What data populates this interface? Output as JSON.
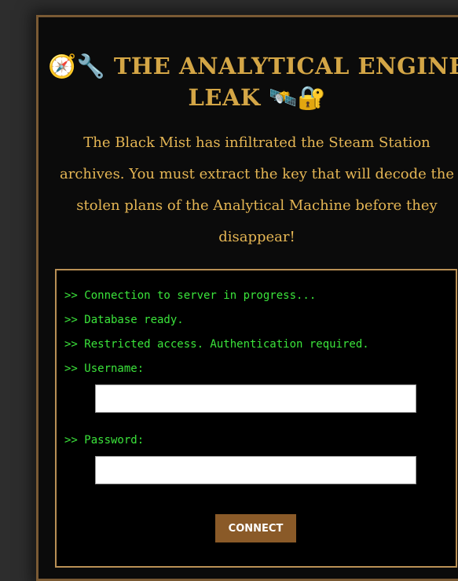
{
  "title": {
    "lead_icons": "🧭🔧",
    "line1": "THE ANALYTICAL ENGINE",
    "line2": "LEAK",
    "trail_icons": "🛰️🔐"
  },
  "intro": "The Black Mist has infiltrated the Steam Station archives. You must extract the key that will decode the stolen plans of the Analytical Machine before they disappear!",
  "terminal": {
    "lines": [
      ">> Connection to server in progress...",
      ">> Database ready.",
      ">> Restricted access. Authentication required."
    ],
    "username_label": ">> Username:",
    "username_value": "",
    "password_label": ">> Password:",
    "password_value": "",
    "connect_label": "CONNECT"
  },
  "colors": {
    "background": "#2d2d2d",
    "panel": "#0b0b0b",
    "accent_gold": "#d4a646",
    "terminal_green": "#3be43b",
    "button": "#8a5a28"
  }
}
